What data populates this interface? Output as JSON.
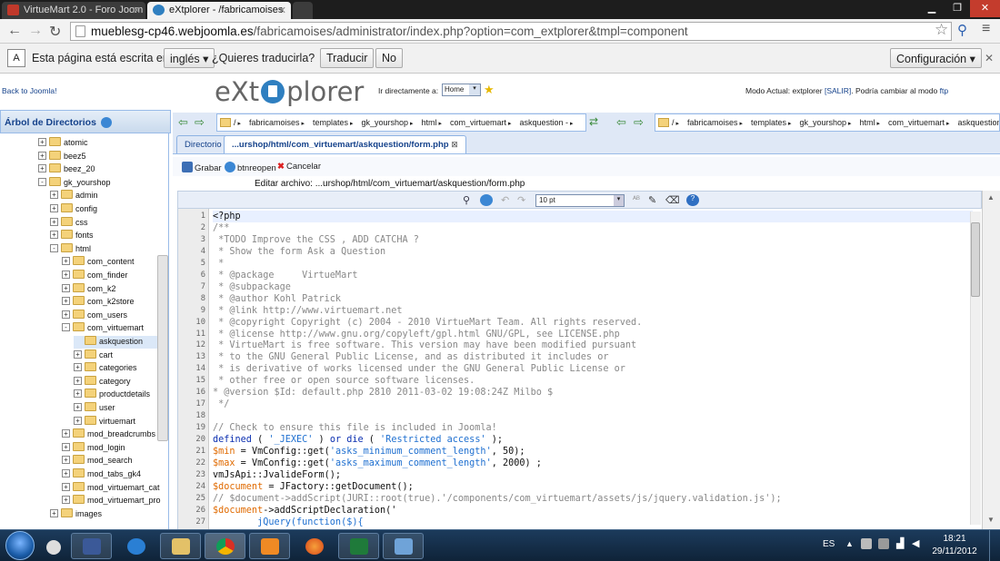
{
  "browser": {
    "tabs": [
      {
        "label": "VirtueMart 2.0 - Foro Joom",
        "active": false
      },
      {
        "label": "eXtplorer - /fabricamoises",
        "active": true
      },
      {
        "label": "",
        "active": false
      }
    ],
    "url": {
      "host": "mueblesg-cp46.webjoomla.es",
      "path": "/fabricamoises/administrator/index.php?option=com_extplorer&tmpl=component"
    }
  },
  "translate_bar": {
    "message": "Esta página está escrita en",
    "language": "inglés",
    "question": "¿Quieres traducirla?",
    "translate_button": "Traducir",
    "no_button": "No",
    "config_button": "Configuración"
  },
  "extplorer": {
    "back_link": "Back to Joomla!",
    "logo_left": "eXt",
    "logo_right": "plorer",
    "goto_label": "Ir directamente a:",
    "goto_value": "Home",
    "mode_prefix": "Modo Actual: extplorer",
    "mode_link": "[SALIR]",
    "mode_mid": ". Podría cambiar al modo",
    "mode_alt": "ftp"
  },
  "tree": {
    "title": "Árbol de Directorios",
    "nodes": [
      {
        "label": "atomic",
        "depth": 0,
        "exp": "+"
      },
      {
        "label": "beez5",
        "depth": 0,
        "exp": "+"
      },
      {
        "label": "beez_20",
        "depth": 0,
        "exp": "+"
      },
      {
        "label": "gk_yourshop",
        "depth": 0,
        "exp": "-"
      },
      {
        "label": "admin",
        "depth": 1,
        "exp": "+"
      },
      {
        "label": "config",
        "depth": 1,
        "exp": "+"
      },
      {
        "label": "css",
        "depth": 1,
        "exp": "+"
      },
      {
        "label": "fonts",
        "depth": 1,
        "exp": "+"
      },
      {
        "label": "html",
        "depth": 1,
        "exp": "-"
      },
      {
        "label": "com_content",
        "depth": 2,
        "exp": "+"
      },
      {
        "label": "com_finder",
        "depth": 2,
        "exp": "+"
      },
      {
        "label": "com_k2",
        "depth": 2,
        "exp": "+"
      },
      {
        "label": "com_k2store",
        "depth": 2,
        "exp": "+"
      },
      {
        "label": "com_users",
        "depth": 2,
        "exp": "+"
      },
      {
        "label": "com_virtuemart",
        "depth": 2,
        "exp": "-"
      },
      {
        "label": "askquestion",
        "depth": 3,
        "exp": "",
        "selected": true
      },
      {
        "label": "cart",
        "depth": 3,
        "exp": "+"
      },
      {
        "label": "categories",
        "depth": 3,
        "exp": "+"
      },
      {
        "label": "category",
        "depth": 3,
        "exp": "+"
      },
      {
        "label": "productdetails",
        "depth": 3,
        "exp": "+"
      },
      {
        "label": "user",
        "depth": 3,
        "exp": "+"
      },
      {
        "label": "virtuemart",
        "depth": 3,
        "exp": "+"
      },
      {
        "label": "mod_breadcrumbs",
        "depth": 2,
        "exp": "+"
      },
      {
        "label": "mod_login",
        "depth": 2,
        "exp": "+"
      },
      {
        "label": "mod_search",
        "depth": 2,
        "exp": "+"
      },
      {
        "label": "mod_tabs_gk4",
        "depth": 2,
        "exp": "+"
      },
      {
        "label": "mod_virtuemart_cat",
        "depth": 2,
        "exp": "+"
      },
      {
        "label": "mod_virtuemart_pro",
        "depth": 2,
        "exp": "+"
      },
      {
        "label": "images",
        "depth": 1,
        "exp": "+"
      }
    ]
  },
  "path_left": [
    "/",
    "fabricamoises",
    "templates",
    "gk_yourshop",
    "html",
    "com_virtuemart",
    "askquestion -"
  ],
  "path_right": [
    "/",
    "fabricamoises",
    "templates",
    "gk_yourshop",
    "html",
    "com_virtuemart",
    "askquestion"
  ],
  "editor_tabs": [
    {
      "label": "Directorio",
      "active": false
    },
    {
      "label": "...urshop/html/com_virtuemart/askquestion/form.php",
      "active": true
    }
  ],
  "toolbar": {
    "save": "Grabar",
    "reopen": "btnreopen",
    "cancel": "Cancelar"
  },
  "edit_label": "Editar archivo: ...urshop/html/com_virtuemart/askquestion/form.php",
  "font_size": "10 pt",
  "code_lines": [
    [
      {
        "t": "<?php",
        "c": "plain"
      }
    ],
    [
      {
        "t": "/**",
        "c": "com"
      }
    ],
    [
      {
        "t": " *TODO Improve the CSS , ADD CATCHA ?",
        "c": "com"
      }
    ],
    [
      {
        "t": " * Show the form Ask a Question",
        "c": "com"
      }
    ],
    [
      {
        "t": " *",
        "c": "com"
      }
    ],
    [
      {
        "t": " * @package     VirtueMart",
        "c": "com"
      }
    ],
    [
      {
        "t": " * @subpackage",
        "c": "com"
      }
    ],
    [
      {
        "t": " * @author Kohl Patrick",
        "c": "com"
      }
    ],
    [
      {
        "t": " * @link http://www.virtuemart.net",
        "c": "com"
      }
    ],
    [
      {
        "t": " * @copyright Copyright (c) 2004 - 2010 VirtueMart Team. All rights reserved.",
        "c": "com"
      }
    ],
    [
      {
        "t": " * @license http://www.gnu.org/copyleft/gpl.html GNU/GPL, see LICENSE.php",
        "c": "com"
      }
    ],
    [
      {
        "t": " * VirtueMart is free software. This version may have been modified pursuant",
        "c": "com"
      }
    ],
    [
      {
        "t": " * to the GNU General Public License, and as distributed it includes or",
        "c": "com"
      }
    ],
    [
      {
        "t": " * is derivative of works licensed under the GNU General Public License or",
        "c": "com"
      }
    ],
    [
      {
        "t": " * other free or open source software licenses.",
        "c": "com"
      }
    ],
    [
      {
        "t": "* @version $Id: default.php 2810 2011-03-02 19:08:24Z Milbo $",
        "c": "com"
      }
    ],
    [
      {
        "t": " */",
        "c": "com"
      }
    ],
    [
      {
        "t": "",
        "c": "plain"
      }
    ],
    [
      {
        "t": "// Check to ensure this file is included in Joomla!",
        "c": "com"
      }
    ],
    [
      {
        "t": "defined",
        "c": "kw"
      },
      {
        "t": " ( ",
        "c": "plain"
      },
      {
        "t": "'_JEXEC'",
        "c": "str"
      },
      {
        "t": " ) ",
        "c": "plain"
      },
      {
        "t": "or die",
        "c": "kw"
      },
      {
        "t": " ( ",
        "c": "plain"
      },
      {
        "t": "'Restricted access'",
        "c": "str"
      },
      {
        "t": " );",
        "c": "plain"
      }
    ],
    [
      {
        "t": "$min",
        "c": "var"
      },
      {
        "t": " = VmConfig::get(",
        "c": "plain"
      },
      {
        "t": "'asks_minimum_comment_length'",
        "c": "str"
      },
      {
        "t": ", 50);",
        "c": "plain"
      }
    ],
    [
      {
        "t": "$max",
        "c": "var"
      },
      {
        "t": " = VmConfig::get(",
        "c": "plain"
      },
      {
        "t": "'asks_maximum_comment_length'",
        "c": "str"
      },
      {
        "t": ", 2000) ;",
        "c": "plain"
      }
    ],
    [
      {
        "t": "vmJsApi::JvalideForm();",
        "c": "plain"
      }
    ],
    [
      {
        "t": "$document",
        "c": "var"
      },
      {
        "t": " = JFactory::getDocument();",
        "c": "plain"
      }
    ],
    [
      {
        "t": "// $document->addScript(JURI::root(true).'/components/com_virtuemart/assets/js/jquery.validation.js');",
        "c": "com"
      }
    ],
    [
      {
        "t": "$document",
        "c": "var"
      },
      {
        "t": "->addScriptDeclaration('",
        "c": "plain"
      }
    ],
    [
      {
        "t": "        jQuery(function($){",
        "c": "str"
      }
    ]
  ],
  "taskbar": {
    "lang": "ES",
    "time": "18:21",
    "date": "29/11/2012"
  },
  "colors": {
    "ext_border": "#99bbe8",
    "ext_title": "#15428b",
    "folder": "#f4d27a"
  }
}
